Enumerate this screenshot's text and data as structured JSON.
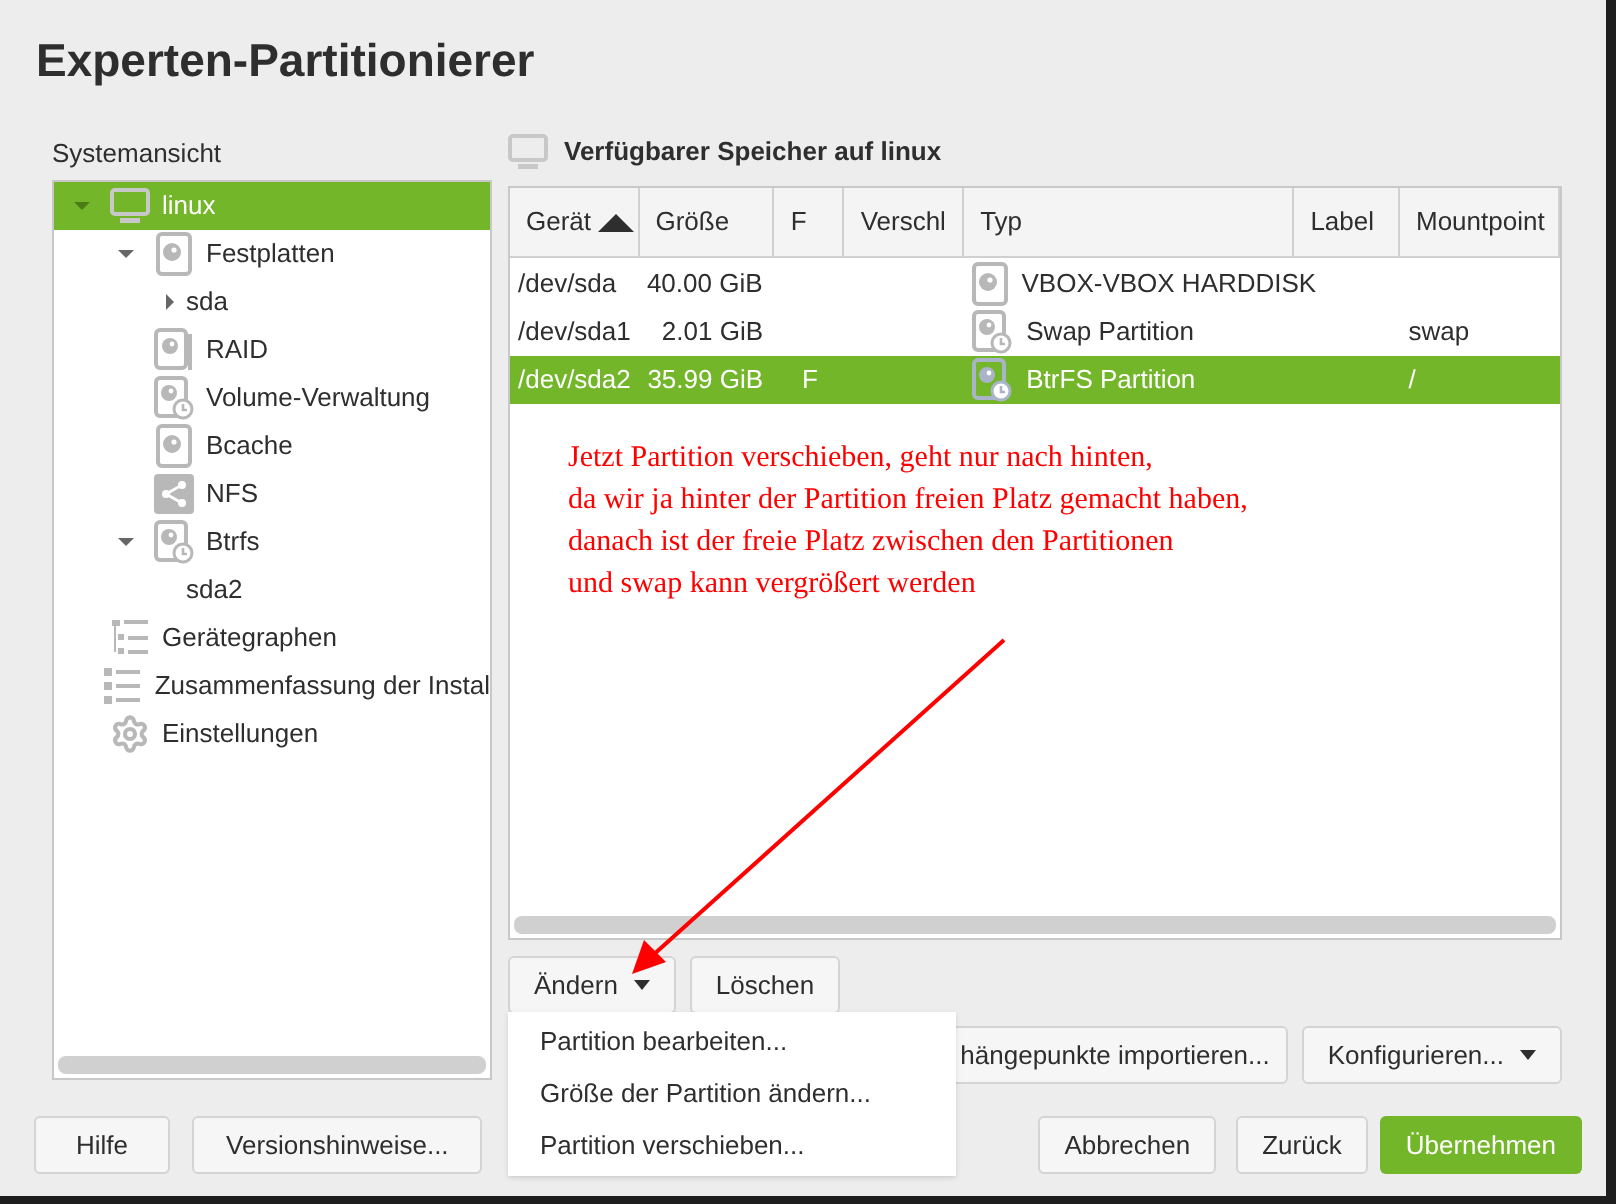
{
  "window": {
    "title": "Experten-Partitionierer"
  },
  "sidebar": {
    "label": "Systemansicht",
    "items": [
      {
        "label": "linux",
        "kind": "monitor",
        "selected": true,
        "expanded": true,
        "children": [
          {
            "label": "Festplatten",
            "kind": "disk",
            "selected": false,
            "expanded": true,
            "children": [
              {
                "label": "sda",
                "selected": false,
                "expanded": false
              }
            ]
          },
          {
            "label": "RAID",
            "kind": "disk-stack",
            "selected": false
          },
          {
            "label": "Volume-Verwaltung",
            "kind": "disk-clock",
            "selected": false
          },
          {
            "label": "Bcache",
            "kind": "disk",
            "selected": false
          },
          {
            "label": "NFS",
            "kind": "share",
            "selected": false
          },
          {
            "label": "Btrfs",
            "kind": "disk-clock",
            "selected": false,
            "expanded": true,
            "children": [
              {
                "label": "sda2",
                "selected": false
              }
            ]
          }
        ]
      },
      {
        "label": "Gerätegraphen",
        "kind": "graph",
        "selected": false
      },
      {
        "label": "Zusammenfassung der Instal",
        "kind": "list",
        "selected": false
      },
      {
        "label": "Einstellungen",
        "kind": "gear",
        "selected": false
      }
    ]
  },
  "panel": {
    "title": "Verfügbarer Speicher auf linux"
  },
  "table": {
    "columns": [
      {
        "label": "Gerät",
        "sorted": true
      },
      {
        "label": "Größe",
        "sorted": false
      },
      {
        "label": "F",
        "sorted": false
      },
      {
        "label": "Verschl",
        "sorted": false
      },
      {
        "label": "Typ",
        "sorted": false
      },
      {
        "label": "Label",
        "sorted": false
      },
      {
        "label": "Mountpoint",
        "sorted": false
      }
    ],
    "rows": [
      {
        "selected": false,
        "device": "/dev/sda",
        "size": "40.00 GiB",
        "f": "",
        "kind": "disk",
        "type": "VBOX-VBOX HARDDISK",
        "mountpoint": ""
      },
      {
        "selected": false,
        "device": "/dev/sda1",
        "size": "2.01 GiB",
        "f": "",
        "kind": "disk-clock",
        "type": "Swap Partition",
        "mountpoint": "swap"
      },
      {
        "selected": true,
        "device": "/dev/sda2",
        "size": "35.99 GiB",
        "f": "F",
        "kind": "disk-clock",
        "type": "BtrFS Partition",
        "mountpoint": "/"
      }
    ]
  },
  "annotation": {
    "lines": [
      "Jetzt Partition verschieben, geht nur nach hinten,",
      "da wir ja hinter der Partition freien Platz gemacht haben,",
      "danach ist der freie Platz zwischen den Partitionen",
      "und swap kann vergrößert werden"
    ]
  },
  "actions": {
    "modify": "Ändern",
    "delete": "Löschen",
    "import": "hängepunkte importieren...",
    "configure": "Konfigurieren..."
  },
  "menu": {
    "items": [
      "Partition bearbeiten...",
      "Größe der Partition ändern...",
      "Partition verschieben..."
    ]
  },
  "footer": {
    "help": "Hilfe",
    "release_notes": "Versionshinweise...",
    "cancel": "Abbrechen",
    "back": "Zurück",
    "accept": "Übernehmen"
  }
}
